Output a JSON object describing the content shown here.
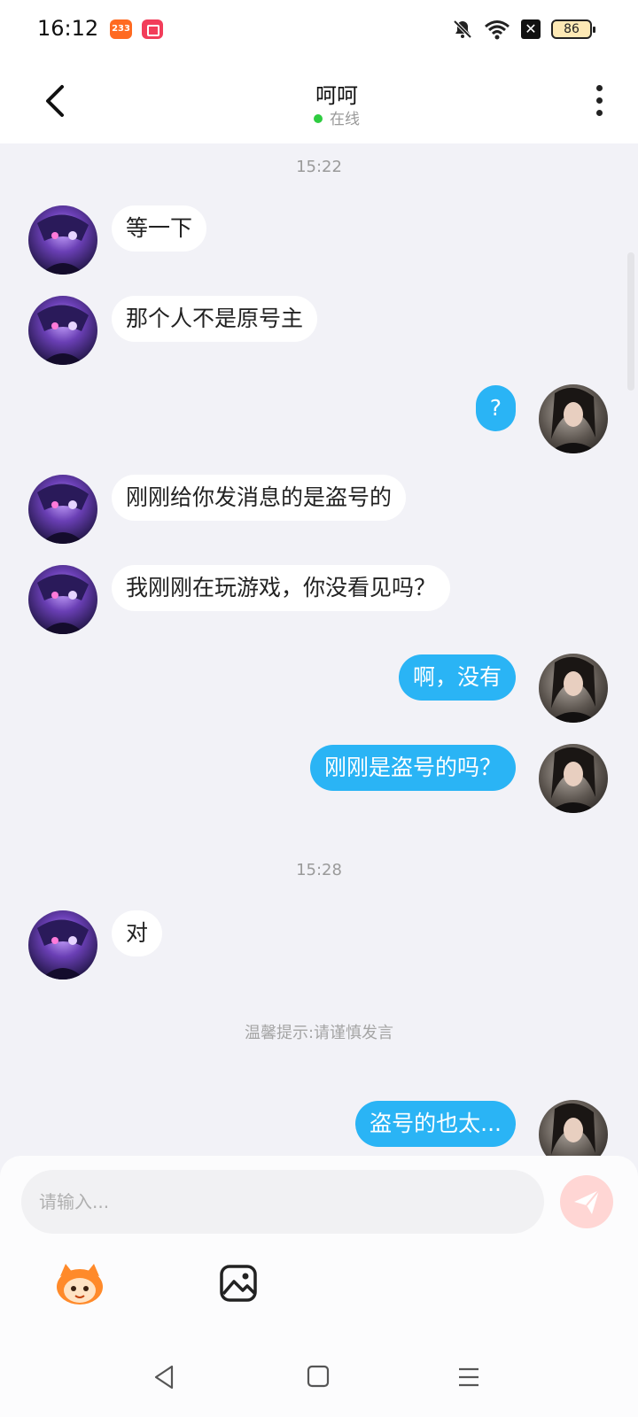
{
  "status_bar": {
    "time": "16:12",
    "app_badge": "233",
    "battery": "86"
  },
  "header": {
    "title": "呵呵",
    "status": "在线"
  },
  "chat": {
    "time_1": "15:22",
    "time_2": "15:28",
    "tip": "温馨提示:请谨慎发言",
    "messages": [
      {
        "side": "in",
        "text": "等一下"
      },
      {
        "side": "in",
        "text": "那个人不是原号主"
      },
      {
        "side": "out",
        "text": "?"
      },
      {
        "side": "in",
        "text": "刚刚给你发消息的是盗号的"
      },
      {
        "side": "in",
        "text": "我刚刚在玩游戏，你没看见吗？"
      },
      {
        "side": "out",
        "text": "啊，没有"
      },
      {
        "side": "out",
        "text": "刚刚是盗号的吗？"
      },
      {
        "side": "in",
        "text": "对"
      },
      {
        "side": "out",
        "text": "盗号的也太..."
      }
    ]
  },
  "input": {
    "placeholder": "请输入..."
  },
  "icons": {
    "back": "back-arrow-icon",
    "more": "more-vertical-icon",
    "send": "send-icon",
    "emoji": "emoji-mascot-icon",
    "image": "image-icon",
    "nav_back": "nav-back-icon",
    "nav_home": "nav-home-icon",
    "nav_menu": "nav-menu-icon"
  },
  "colors": {
    "outgoing_bubble": "#2ab4f5",
    "incoming_bubble": "#ffffff",
    "send_button": "#ffd6d4",
    "online_dot": "#2ecc40"
  }
}
